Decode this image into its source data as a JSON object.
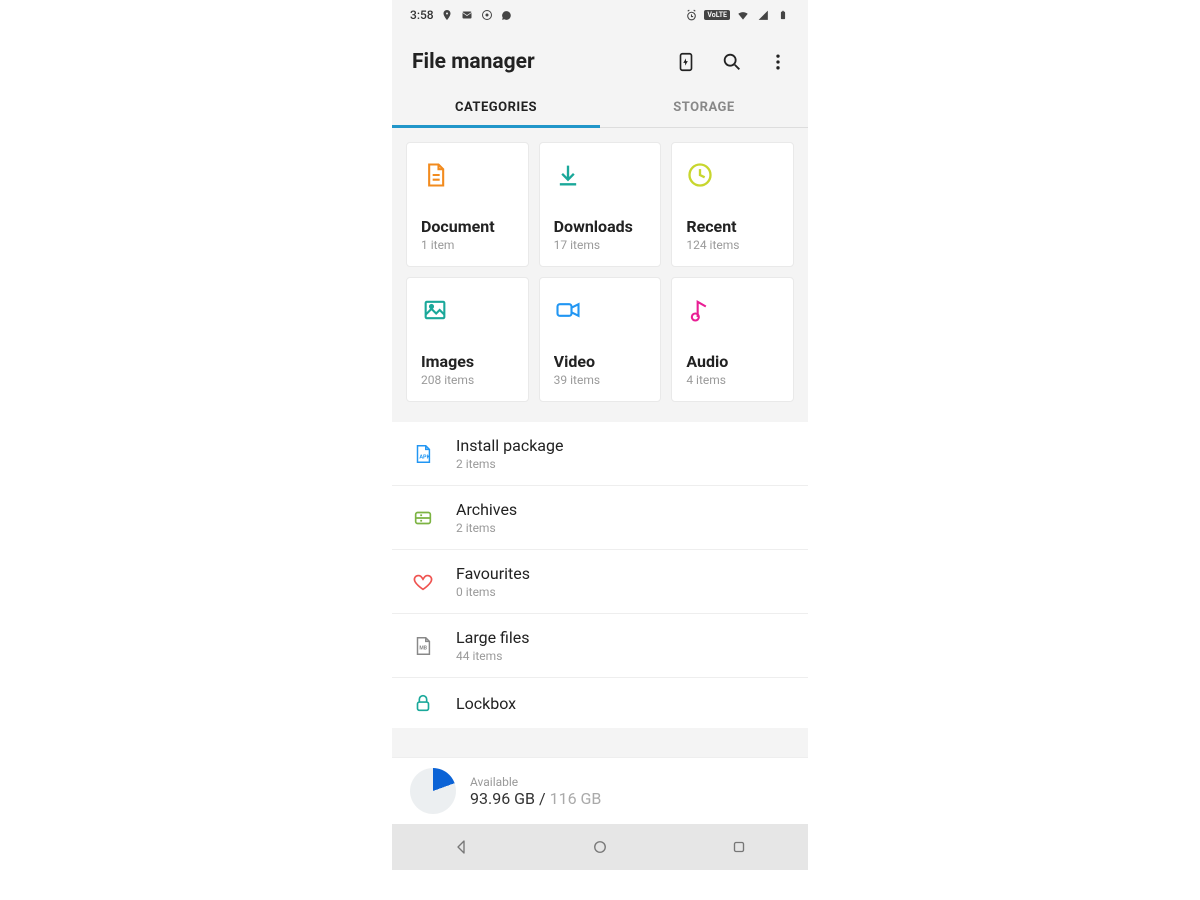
{
  "status": {
    "time": "3:58",
    "left_icons": [
      "location-icon",
      "mail-icon",
      "chrome-icon",
      "speech-icon"
    ],
    "right_icons": [
      "alarm-icon",
      "volte-badge",
      "wifi-icon",
      "cell-icon",
      "battery-icon"
    ]
  },
  "header": {
    "title": "File manager"
  },
  "tabs": [
    {
      "label": "CATEGORIES",
      "active": true
    },
    {
      "label": "STORAGE",
      "active": false
    }
  ],
  "cards": [
    {
      "title": "Document",
      "sub": "1 item",
      "icon": "document",
      "color": "#f28b1e"
    },
    {
      "title": "Downloads",
      "sub": "17 items",
      "icon": "download",
      "color": "#1aa89a"
    },
    {
      "title": "Recent",
      "sub": "124 items",
      "icon": "clock",
      "color": "#cddc39"
    },
    {
      "title": "Images",
      "sub": "208 items",
      "icon": "image",
      "color": "#1aa89a"
    },
    {
      "title": "Video",
      "sub": "39 items",
      "icon": "video",
      "color": "#2196f3"
    },
    {
      "title": "Audio",
      "sub": "4 items",
      "icon": "audio",
      "color": "#e91e94"
    }
  ],
  "list": [
    {
      "title": "Install package",
      "sub": "2 items",
      "icon": "apk",
      "color": "#2196f3"
    },
    {
      "title": "Archives",
      "sub": "2 items",
      "icon": "archive",
      "color": "#7cb342"
    },
    {
      "title": "Favourites",
      "sub": "0 items",
      "icon": "heart",
      "color": "#ef5350"
    },
    {
      "title": "Large files",
      "sub": "44 items",
      "icon": "large",
      "color": "#888888"
    },
    {
      "title": "Lockbox",
      "sub": "",
      "icon": "lock",
      "color": "#1aa89a"
    }
  ],
  "storage": {
    "label": "Available",
    "free": "93.96 GB",
    "sep": " / ",
    "total": "116 GB"
  }
}
